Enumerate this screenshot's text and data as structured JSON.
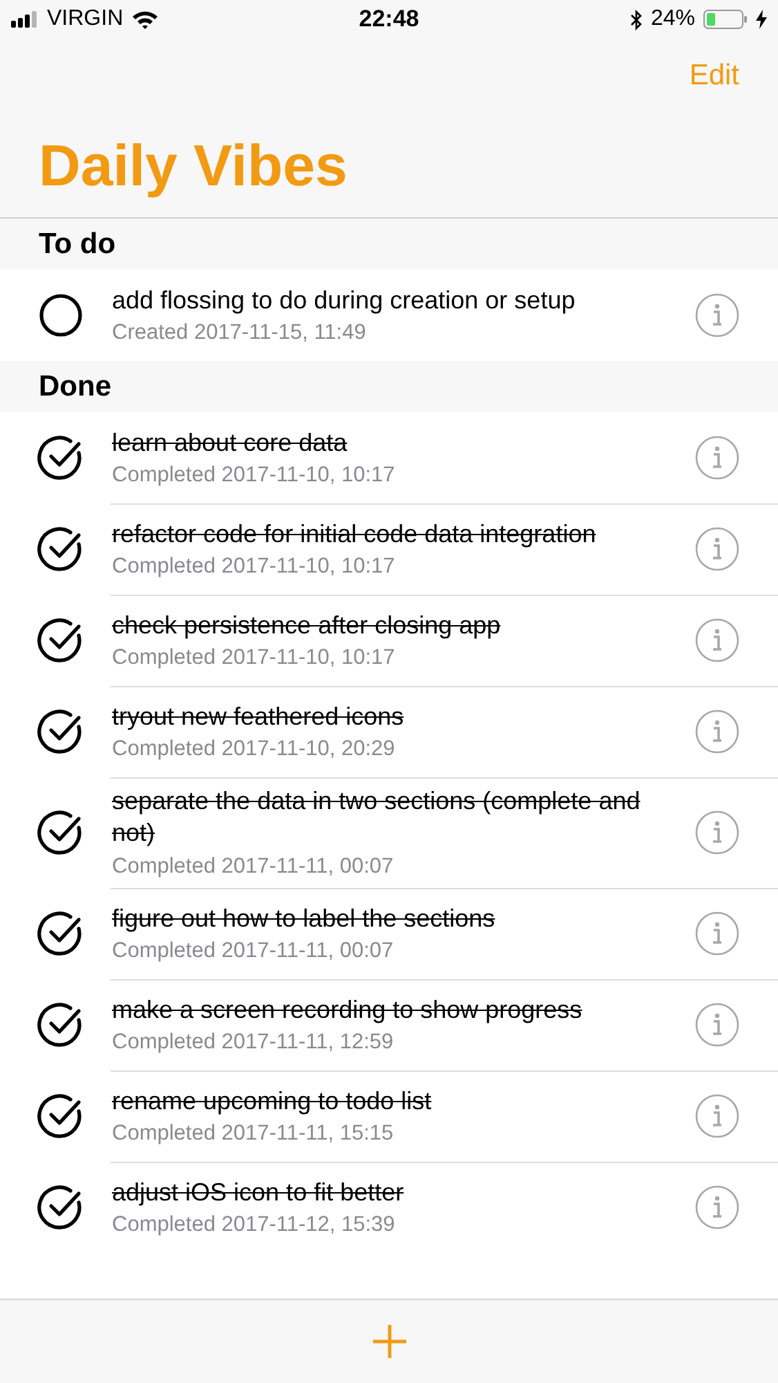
{
  "status_bar": {
    "carrier": "VIRGIN",
    "time": "22:48",
    "battery": "24%"
  },
  "nav": {
    "action": "Edit",
    "title": "Daily Vibes"
  },
  "sections": [
    {
      "title": "To do",
      "items": [
        {
          "text": "add flossing to do during creation or setup",
          "meta": "Created 2017-11-15, 11:49",
          "done": false
        }
      ]
    },
    {
      "title": "Done",
      "items": [
        {
          "text": "learn about core data",
          "meta": "Completed 2017-11-10, 10:17",
          "done": true
        },
        {
          "text": "refactor code for initial code data integration",
          "meta": "Completed 2017-11-10, 10:17",
          "done": true
        },
        {
          "text": "check persistence after closing app",
          "meta": "Completed 2017-11-10, 10:17",
          "done": true
        },
        {
          "text": "tryout new feathered icons",
          "meta": "Completed 2017-11-10, 20:29",
          "done": true
        },
        {
          "text": "separate the data in two sections (complete and not)",
          "meta": "Completed 2017-11-11, 00:07",
          "done": true
        },
        {
          "text": "figure out how to label the sections",
          "meta": "Completed 2017-11-11, 00:07",
          "done": true
        },
        {
          "text": "make a screen recording to show progress",
          "meta": "Completed 2017-11-11, 12:59",
          "done": true
        },
        {
          "text": "rename upcoming to todo list",
          "meta": "Completed 2017-11-11, 15:15",
          "done": true
        },
        {
          "text": "adjust iOS icon to fit better",
          "meta": "Completed 2017-11-12, 15:39",
          "done": true
        }
      ]
    }
  ]
}
